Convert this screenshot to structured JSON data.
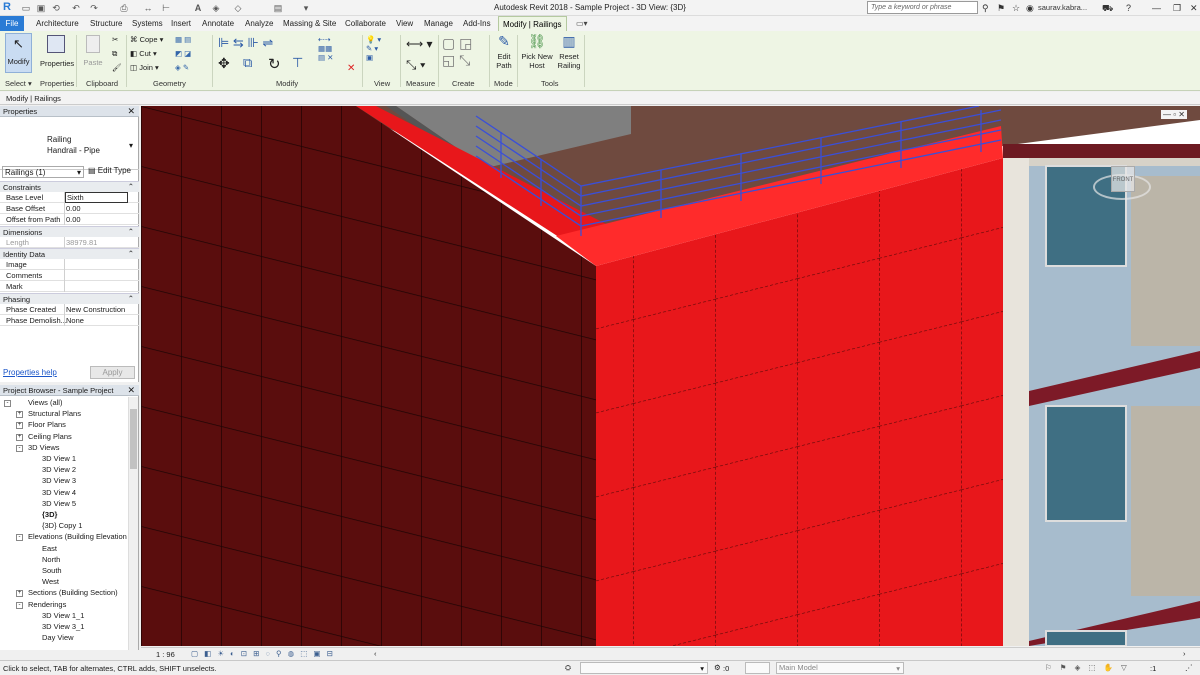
{
  "window": {
    "title": "Autodesk Revit 2018 -    Sample Project - 3D View: {3D}"
  },
  "titlebar": {
    "search_placeholder": "Type a keyword or phrase",
    "user": "saurav.kabra..."
  },
  "tabs": [
    "File",
    "Architecture",
    "Structure",
    "Systems",
    "Insert",
    "Annotate",
    "Analyze",
    "Massing & Site",
    "Collaborate",
    "View",
    "Manage",
    "Add-Ins",
    "Modify | Railings"
  ],
  "ribbon": {
    "modify_label": "Modify",
    "properties_label": "Properties",
    "paste_label": "Paste",
    "cope_label": "Cope",
    "cut_label": "Cut",
    "join_label": "Join",
    "edit_path_label": "Edit Path",
    "pick_new_host_label": "Pick New Host",
    "reset_railing_label": "Reset Railing",
    "panels": {
      "select": "Select",
      "properties": "Properties",
      "clipboard": "Clipboard",
      "geometry": "Geometry",
      "modify": "Modify",
      "view": "View",
      "measure": "Measure",
      "create": "Create",
      "mode": "Mode",
      "tools": "Tools"
    }
  },
  "context_bar": {
    "text": "Modify | Railings"
  },
  "properties": {
    "header": "Properties",
    "type_family": "Railing",
    "type_name": "Handrail - Pipe",
    "selector": "Railings (1)",
    "edit_type": "Edit Type",
    "groups": {
      "constraints": "Constraints",
      "dimensions": "Dimensions",
      "identity": "Identity Data",
      "phasing": "Phasing"
    },
    "rows": {
      "base_level": {
        "k": "Base Level",
        "v": "Sixth"
      },
      "base_offset": {
        "k": "Base Offset",
        "v": "0.00"
      },
      "offset_path": {
        "k": "Offset from Path",
        "v": "0.00"
      },
      "length": {
        "k": "Length",
        "v": "38979.81"
      },
      "image": {
        "k": "Image",
        "v": ""
      },
      "comments": {
        "k": "Comments",
        "v": ""
      },
      "mark": {
        "k": "Mark",
        "v": ""
      },
      "phase_created": {
        "k": "Phase Created",
        "v": "New Construction"
      },
      "phase_demolished": {
        "k": "Phase Demolish...",
        "v": "None"
      }
    },
    "help": "Properties help",
    "apply": "Apply"
  },
  "browser": {
    "header": "Project Browser - Sample Project",
    "items": [
      {
        "label": "Views (all)",
        "indent": 0,
        "exp": "-"
      },
      {
        "label": "Structural Plans",
        "indent": 1,
        "exp": "+"
      },
      {
        "label": "Floor Plans",
        "indent": 1,
        "exp": "+"
      },
      {
        "label": "Ceiling Plans",
        "indent": 1,
        "exp": "+"
      },
      {
        "label": "3D Views",
        "indent": 1,
        "exp": "-"
      },
      {
        "label": "3D View 1",
        "indent": 2,
        "exp": ""
      },
      {
        "label": "3D View 2",
        "indent": 2,
        "exp": ""
      },
      {
        "label": "3D View 3",
        "indent": 2,
        "exp": ""
      },
      {
        "label": "3D View 4",
        "indent": 2,
        "exp": ""
      },
      {
        "label": "3D View 5",
        "indent": 2,
        "exp": ""
      },
      {
        "label": "{3D}",
        "indent": 2,
        "exp": "",
        "bold": true
      },
      {
        "label": "{3D} Copy 1",
        "indent": 2,
        "exp": ""
      },
      {
        "label": "Elevations (Building Elevation",
        "indent": 1,
        "exp": "-"
      },
      {
        "label": "East",
        "indent": 2,
        "exp": ""
      },
      {
        "label": "North",
        "indent": 2,
        "exp": ""
      },
      {
        "label": "South",
        "indent": 2,
        "exp": ""
      },
      {
        "label": "West",
        "indent": 2,
        "exp": ""
      },
      {
        "label": "Sections (Building Section)",
        "indent": 1,
        "exp": "+"
      },
      {
        "label": "Renderings",
        "indent": 1,
        "exp": "-"
      },
      {
        "label": "3D View 1_1",
        "indent": 2,
        "exp": ""
      },
      {
        "label": "3D View 3_1",
        "indent": 2,
        "exp": ""
      },
      {
        "label": "Day View",
        "indent": 2,
        "exp": ""
      }
    ]
  },
  "viewcube": {
    "face": "FRONT"
  },
  "viewbar": {
    "scale": "1 : 96"
  },
  "status": {
    "hint": "Click to select, TAB for alternates, CTRL adds, SHIFT unselects.",
    "sel_count": ":0",
    "model": "Main Model",
    "filter_count": ":1"
  },
  "colors": {
    "accent_tab": "#2a7bd5",
    "ribbon_bg": "#eef5e4",
    "panel_red": "#e8171b",
    "panel_dark": "#5a0d0d",
    "railing_blue": "#3a4fd8"
  }
}
